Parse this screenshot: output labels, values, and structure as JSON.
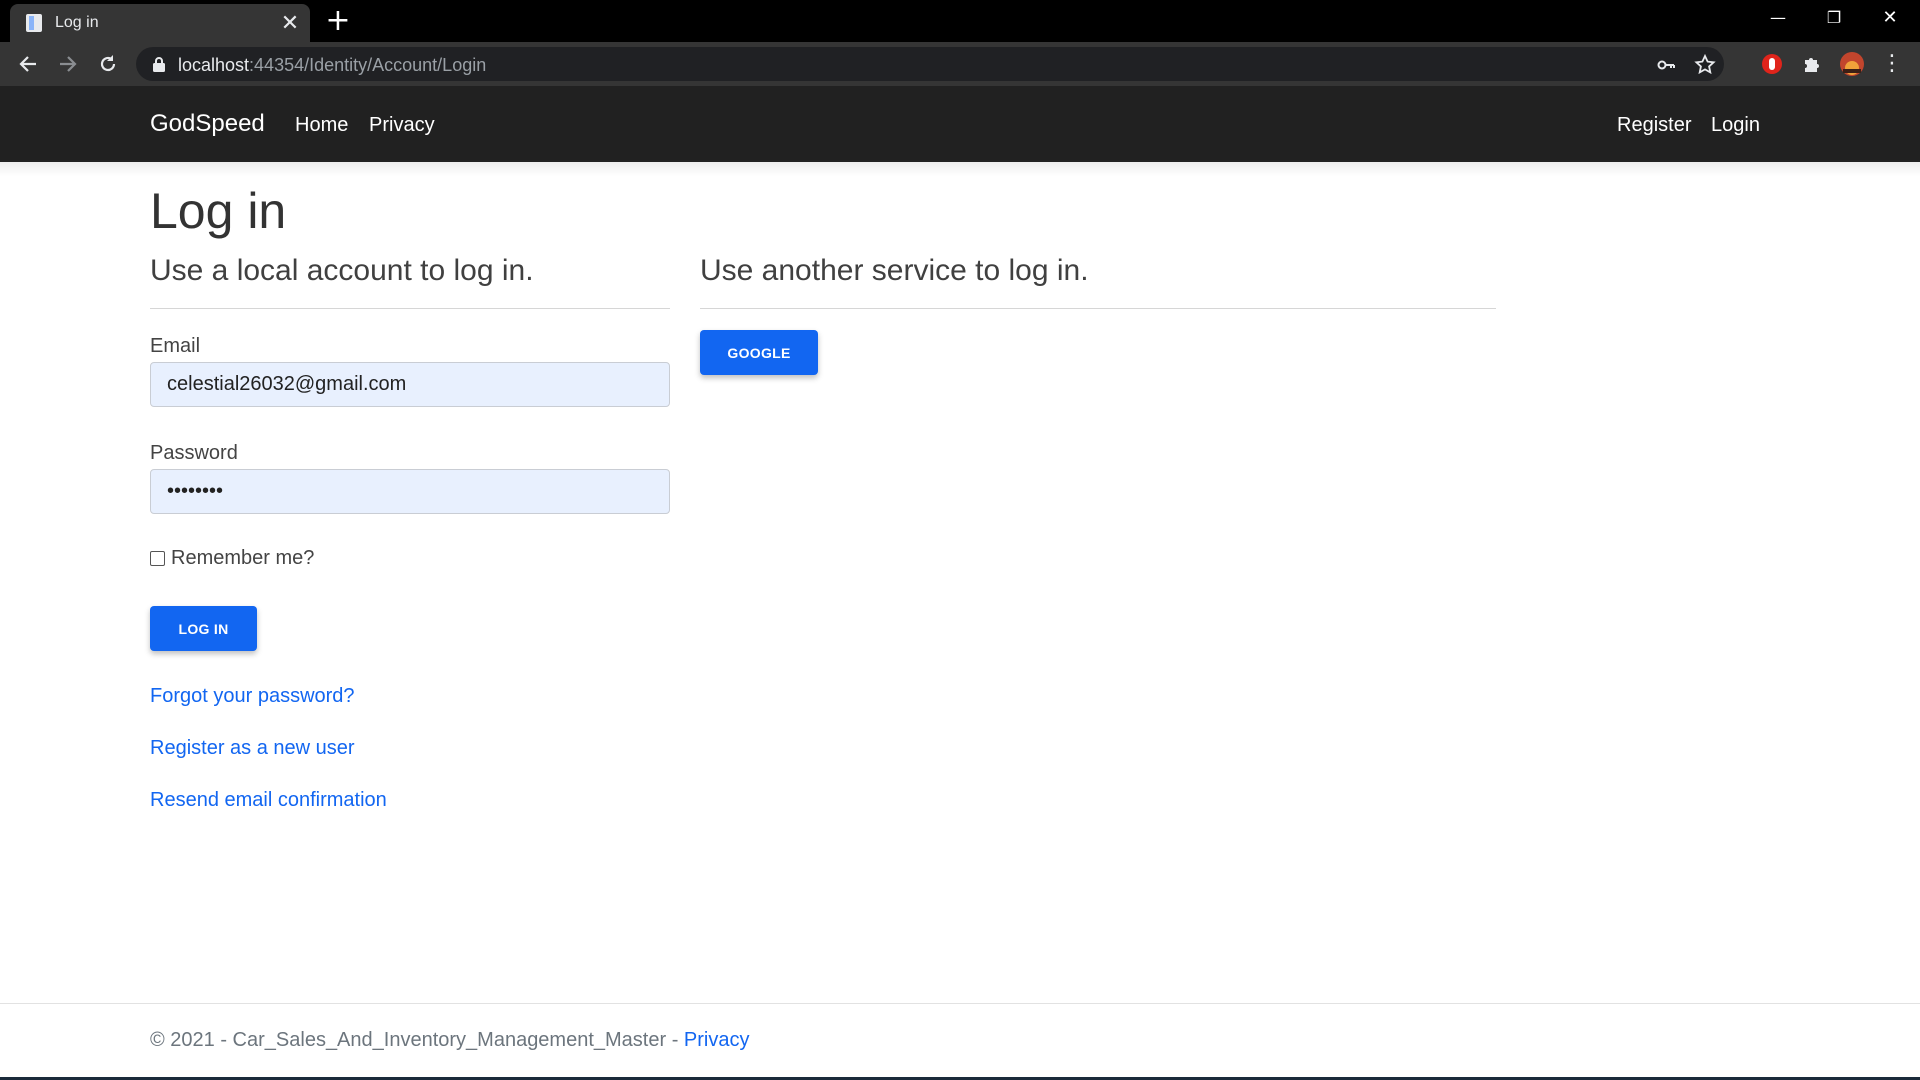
{
  "browser": {
    "tab_title": "Log in",
    "tab_close": "✕",
    "new_tab": "+",
    "url_host": "localhost",
    "url_rest": ":44354/Identity/Account/Login",
    "window_controls": {
      "minimize": "—",
      "restore": "❐",
      "close": "✕"
    }
  },
  "navbar": {
    "brand": "GodSpeed",
    "links": [
      "Home",
      "Privacy"
    ],
    "right_links": [
      "Register",
      "Login"
    ]
  },
  "page": {
    "title": "Log in",
    "local_heading": "Use a local account to log in.",
    "external_heading": "Use another service to log in.",
    "email_label": "Email",
    "email_value": "celestial26032@gmail.com",
    "password_label": "Password",
    "password_value": "••••••••",
    "remember_label": "Remember me?",
    "login_button": "LOG IN",
    "google_button": "GOOGLE",
    "forgot_link": "Forgot your password?",
    "register_link": "Register as a new user",
    "resend_link": "Resend email confirmation"
  },
  "footer": {
    "text": "© 2021 - Car_Sales_And_Inventory_Management_Master - ",
    "privacy_link": "Privacy"
  },
  "colors": {
    "primary": "#1266f1",
    "navbar_bg": "#212121",
    "input_bg": "#e8f0fe"
  }
}
